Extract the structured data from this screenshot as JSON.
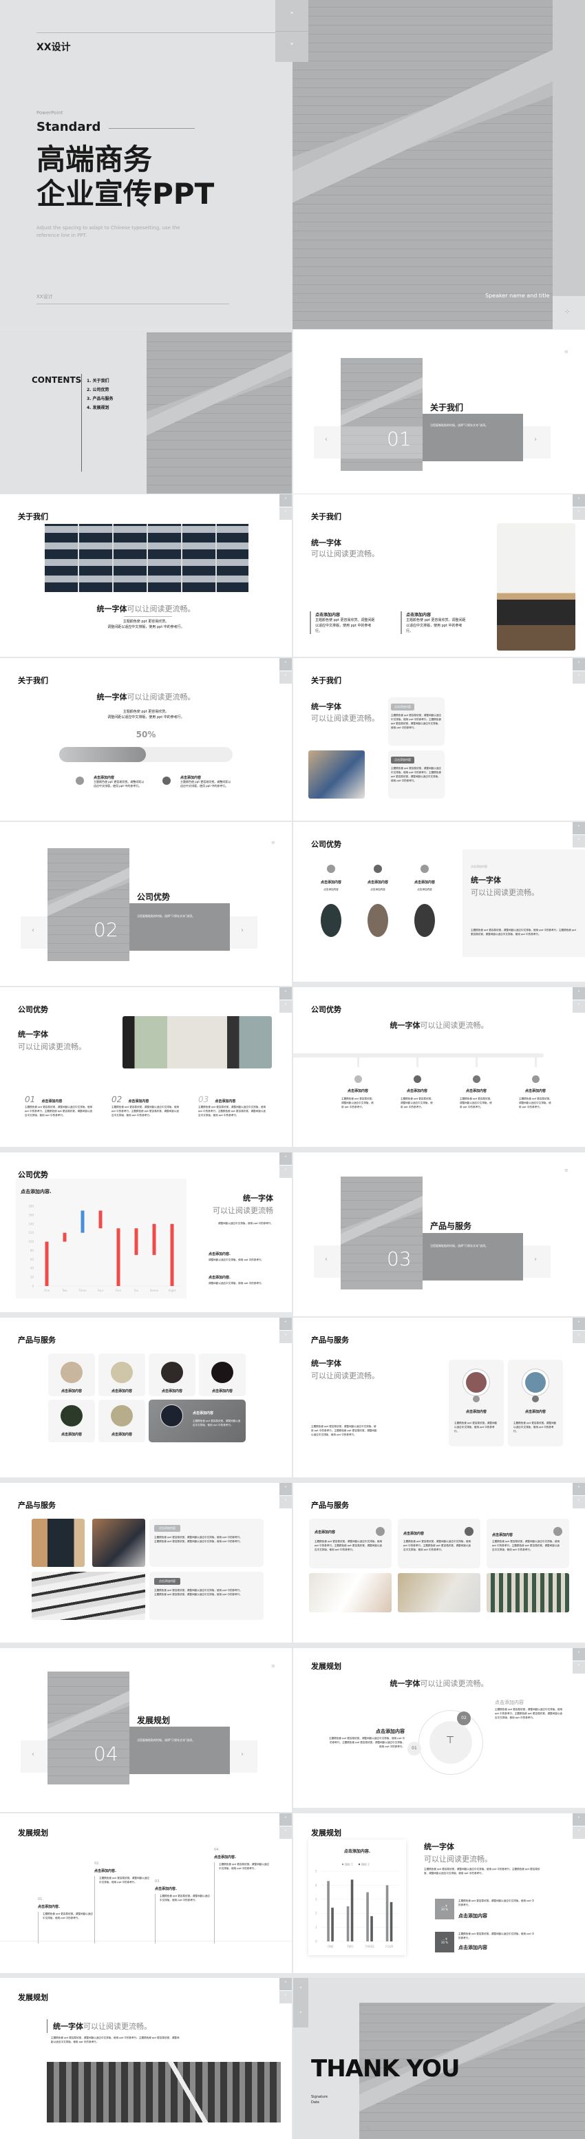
{
  "cover": {
    "brand": "XX设计",
    "kicker": "PowerPoint",
    "subtitle": "Standard",
    "title_line1": "高端商务",
    "title_line2": "企业宣传PPT",
    "desc": "Adjust the spacing to adapt to Chinese typesetting, use the reference line in PPT.",
    "footer_brand": "XX设计",
    "speaker": "Speaker name and title"
  },
  "contents": {
    "heading": "CONTENTS",
    "items": [
      "1.  关于我们",
      "2.  公司优势",
      "3.  产品与服务",
      "4.  发展规划"
    ]
  },
  "sections": [
    {
      "num": "01",
      "title": "关于我们",
      "note": "当您复制粘贴的时候，选择“只保存文本”选项。"
    },
    {
      "num": "02",
      "title": "公司优势",
      "note": "当您复制粘贴的时候，选择“只保存文本”选项。"
    },
    {
      "num": "03",
      "title": "产品与服务",
      "note": "当您复制粘贴的时候，选择“只保存文本”选项。"
    },
    {
      "num": "04",
      "title": "发展规划",
      "note": "当您复制粘贴的时候，选择“只保存文本”选项。"
    }
  ],
  "common": {
    "headline_bold": "统一字体",
    "headline_grey": "可以让阅读更流畅。",
    "headline_grey_noperiod": "可以让阅读更流畅",
    "add_content": "点击添加内容",
    "add_content_dot": "点击添加内容.",
    "body_short": "主题颜色使 ppt 更容易欣赏。",
    "body_short2": "调整间距以适应中文排版，使用 ppt 中的参考行。",
    "body_two": "主题颜色使 ppt 更容易欣赏。调整间距以适应中文排版，使用 ppt 中的参考行。",
    "body_long": "主题颜色使 ppt 更容易欣赏，调整间距以适应中文排版，使用 ppt 中的参考行。主题颜色使 ppt 更容易欣赏，调整间距以适应中文排版，使用 ppt 中的参考行。",
    "body_sub": "点击添加内容",
    "nav_up": "˄",
    "nav_down": "˅",
    "prev": "‹",
    "next": "›"
  },
  "progress": {
    "label": "50%",
    "value": 0.5
  },
  "steps": [
    "01",
    "02",
    "03"
  ],
  "timeline": [
    "01.",
    "02.",
    "03.",
    "04."
  ],
  "process": [
    "01",
    "02"
  ],
  "stat_boxes": [
    {
      "line1": "... ¥",
      "line2": "30 %"
    },
    {
      "line1": "... ¥",
      "line2": "30 %"
    }
  ],
  "thankyou": {
    "title": "THANK YOU",
    "signature": "Signature",
    "date": "Date"
  },
  "chart_data": [
    {
      "type": "bar",
      "subtype": "floating",
      "title": "点击添加内容.",
      "categories": [
        "One",
        "Two",
        "Three",
        "Four",
        "Five",
        "Six",
        "Seven",
        "Eight"
      ],
      "ranges": [
        [
          0,
          100
        ],
        [
          100,
          120
        ],
        [
          120,
          170
        ],
        [
          130,
          170
        ],
        [
          0,
          130
        ],
        [
          70,
          130
        ],
        [
          70,
          140
        ],
        [
          0,
          140
        ]
      ],
      "colors": [
        "#f04b4b",
        "#f04b4b",
        "#4a90d9",
        "#f04b4b",
        "#f04b4b",
        "#f04b4b",
        "#f04b4b",
        "#f04b4b"
      ],
      "ylim": [
        0,
        180
      ],
      "yticks": [
        0,
        20,
        40,
        60,
        80,
        100,
        120,
        140,
        160,
        180
      ],
      "grid": false
    },
    {
      "type": "bar",
      "title": "点击添加内容.",
      "categories": [
        "ONE",
        "TWO",
        "THREE",
        "FOUR"
      ],
      "series": [
        {
          "name": "指标 1",
          "values": [
            4.3,
            2.5,
            3.5,
            4.0
          ],
          "color": "#8e9092"
        },
        {
          "name": "指标 2",
          "values": [
            2.4,
            4.4,
            1.8,
            2.8
          ],
          "color": "#5a5c5e"
        }
      ],
      "ylim": [
        0,
        5
      ],
      "yticks": [
        0,
        1,
        2,
        3,
        4,
        5
      ],
      "legend": "top",
      "grid": true
    }
  ]
}
